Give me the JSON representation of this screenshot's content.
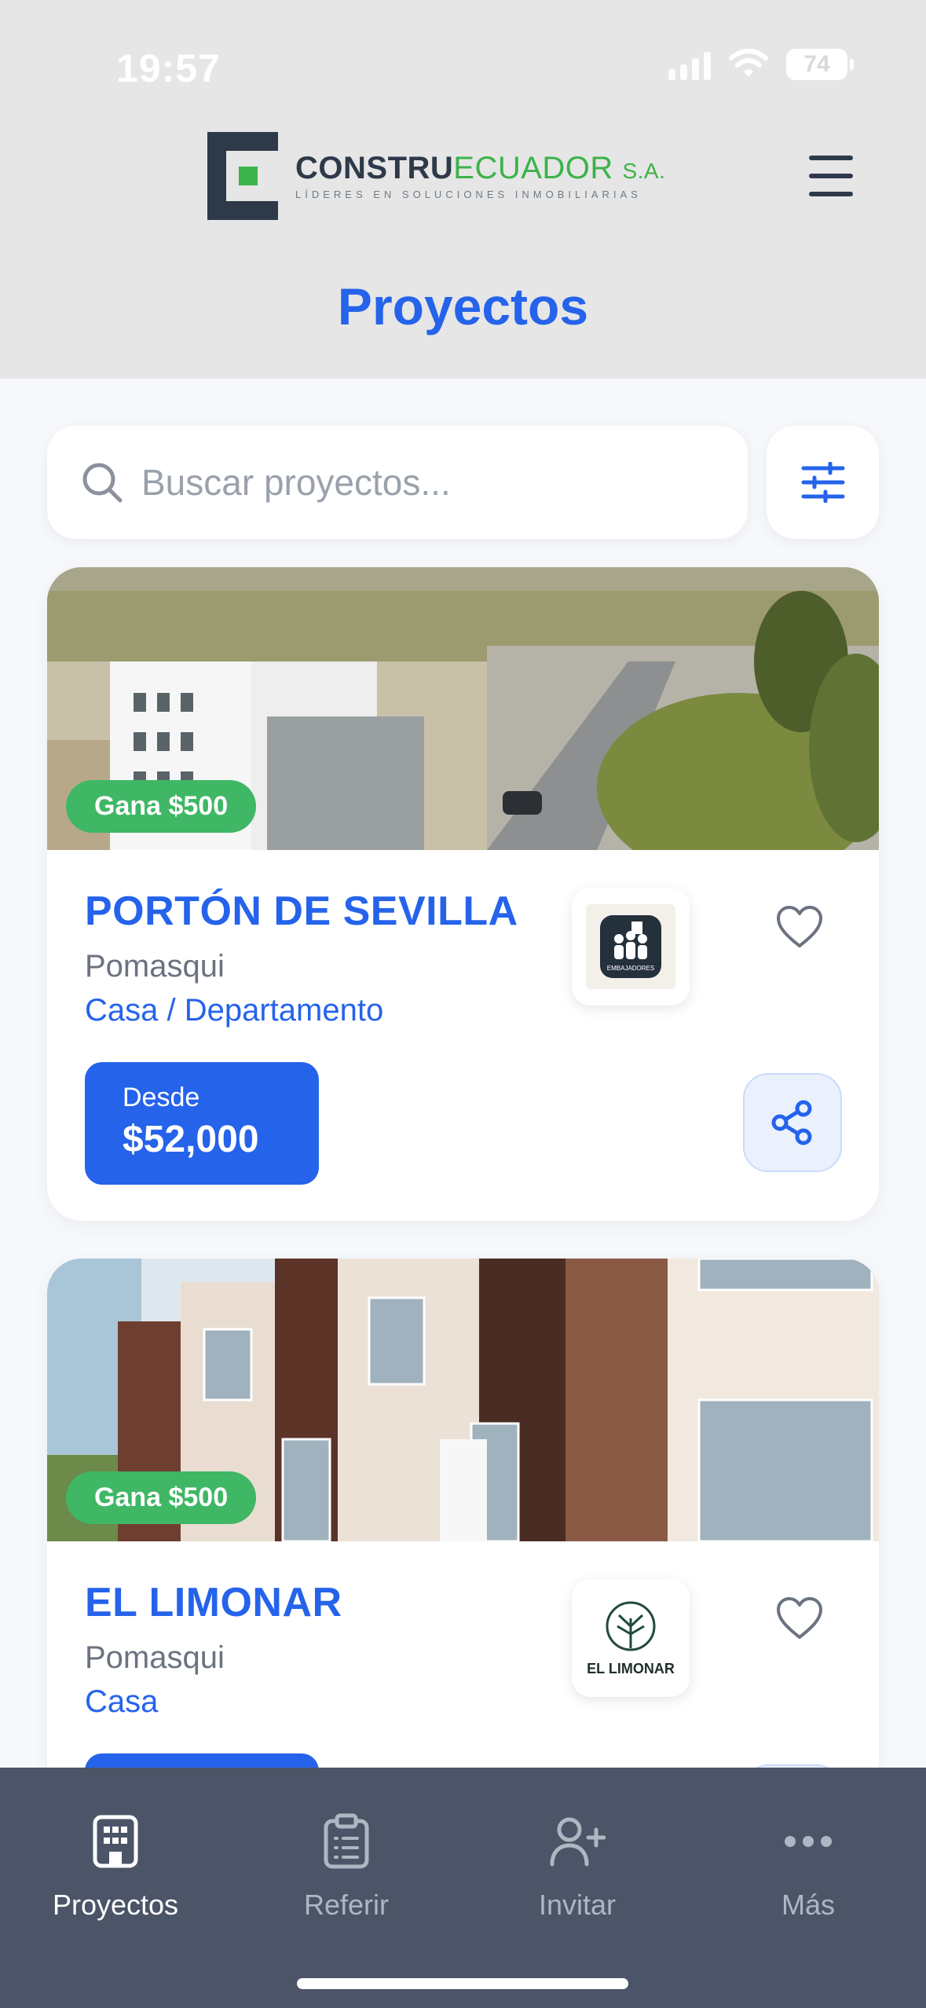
{
  "status": {
    "time": "19:57",
    "battery": "74"
  },
  "brand": {
    "name_a": "CONSTRU",
    "name_b": "ECUADOR",
    "suffix": "S.A.",
    "tagline": "LÍDERES EN SOLUCIONES INMOBILIARIAS"
  },
  "page": {
    "title": "Proyectos"
  },
  "search": {
    "placeholder": "Buscar proyectos..."
  },
  "projects": [
    {
      "title": "PORTÓN DE SEVILLA",
      "location": "Pomasqui",
      "type": "Casa / Departamento",
      "badge": "Gana $500",
      "price_label": "Desde",
      "price": "$52,000",
      "brand_logo_text": "EMBAJADORES"
    },
    {
      "title": "EL LIMONAR",
      "location": "Pomasqui",
      "type": "Casa",
      "badge": "Gana $500",
      "brand_logo_text": "EL LIMONAR"
    }
  ],
  "nav": {
    "items": [
      {
        "label": "Proyectos",
        "icon": "building-icon",
        "active": true
      },
      {
        "label": "Referir",
        "icon": "clipboard-icon",
        "active": false
      },
      {
        "label": "Invitar",
        "icon": "user-plus-icon",
        "active": false
      },
      {
        "label": "Más",
        "icon": "more-icon",
        "active": false
      }
    ]
  },
  "colors": {
    "primary": "#2563eb",
    "badge": "#3fb765",
    "nav_bg": "#4b5567",
    "header_bg": "#e6e6e6"
  }
}
